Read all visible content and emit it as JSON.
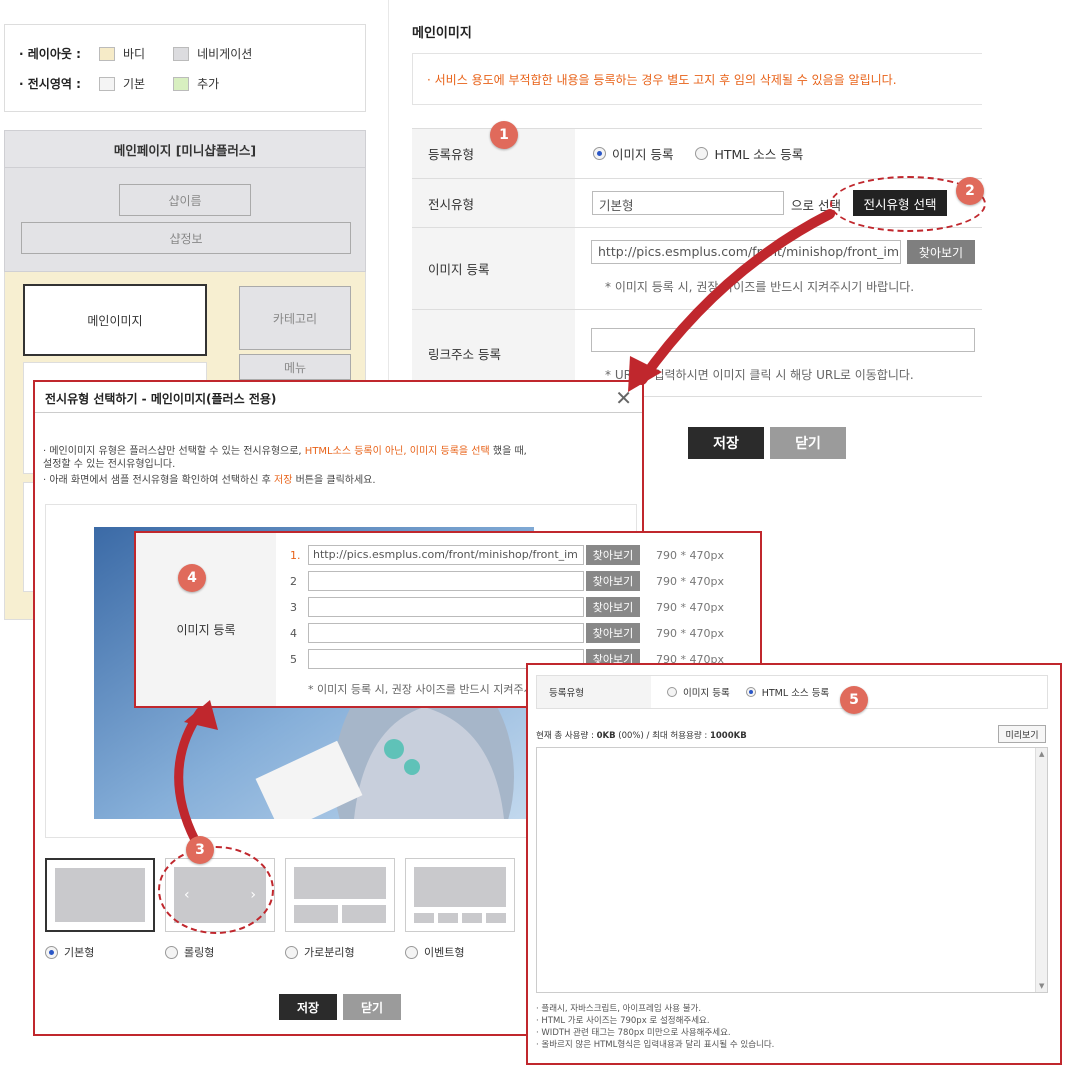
{
  "legend": {
    "layout_label": "· 레이아웃 :",
    "display_label": "· 전시영역 :",
    "items_layout": [
      {
        "label": "바디",
        "color": "#f6ebc8"
      },
      {
        "label": "네비게이션",
        "color": "#dcdcdf"
      }
    ],
    "items_display": [
      {
        "label": "기본",
        "color": "#f4f4f4"
      },
      {
        "label": "추가",
        "color": "#d8efc0"
      }
    ]
  },
  "map": {
    "title": "메인페이지 [미니샵플러스]",
    "shop_name": "샵이름",
    "shop_info": "샵정보",
    "main_image": "메인이미지",
    "category": "카테고리",
    "menu": "메뉴"
  },
  "right": {
    "section_title": "메인이미지",
    "notice": "· 서비스 용도에 부적합한 내용을 등록하는 경우 별도 고지 후 임의 삭제될 수 있음을 알립니다.",
    "reg_type_label": "등록유형",
    "reg_type_options": [
      "이미지 등록",
      "HTML 소스 등록"
    ],
    "display_type_label": "전시유형",
    "display_type_value": "기본형",
    "display_select_suffix": "으로 선택",
    "display_select_button": "전시유형 선택",
    "image_reg_label": "이미지 등록",
    "image_url": "http://pics.esmplus.com/front/minishop/front_im",
    "browse": "찾아보기",
    "image_hint": "* 이미지 등록 시, 권장 사이즈를 반드시 지켜주시기 바랍니다.",
    "link_label": "링크주소 등록",
    "link_hint": "* URL을 입력하시면 이미지 클릭 시 해당 URL로 이동합니다.",
    "save": "저장",
    "close": "닫기"
  },
  "popup": {
    "title": "전시유형 선택하기 - 메인이미지(플러스 전용)",
    "desc_line1_a": "· 메인이미지 유형은 플러스샵만 선택할 수 있는 전시유형으로, ",
    "desc_line1_b": "HTML소스 등록이 아닌, 이미지 등록을 선택",
    "desc_line1_c": " 했을 때,",
    "desc_line2": "  설정할 수 있는 전시유형입니다.",
    "desc_line3_a": "· 아래 화면에서 샘플 전시유형을 확인하여 선택하신 후 ",
    "desc_line3_b": "저장",
    "desc_line3_c": " 버튼을 클릭하세요.",
    "types": [
      "기본형",
      "롤링형",
      "가로분리형",
      "이벤트형"
    ],
    "selected_type": "기본형",
    "save": "저장",
    "close": "닫기"
  },
  "regbox": {
    "label": "이미지 등록",
    "rows": [
      {
        "num": "1.",
        "value": "http://pics.esmplus.com/front/minishop/front_im",
        "size": "790 * 470px"
      },
      {
        "num": "2",
        "value": "",
        "size": "790 * 470px"
      },
      {
        "num": "3",
        "value": "",
        "size": "790 * 470px"
      },
      {
        "num": "4",
        "value": "",
        "size": "790 * 470px"
      },
      {
        "num": "5",
        "value": "",
        "size": "790 * 470px"
      }
    ],
    "browse": "찾아보기",
    "hint": "* 이미지 등록 시, 권장 사이즈를 반드시 지켜주시"
  },
  "htmlbox": {
    "reg_type_label": "등록유형",
    "options": [
      "이미지 등록",
      "HTML 소스 등록"
    ],
    "usage_a": "현재 총 사용량 : ",
    "usage_b": "0KB",
    "usage_c": " (00%)  /  최대 허용용량 : ",
    "usage_d": "1000KB",
    "preview_button": "미리보기",
    "notes": [
      {
        "text": "· 플래시, 자바스크립트, 아이프레임 사용 불가.",
        "accent": true
      },
      {
        "text": "· HTML 가로 사이즈는 790px 로 설정해주세요.",
        "accent": false
      },
      {
        "text": "· WIDTH 관련 태그는 780px 미만으로 사용해주세요.",
        "accent": false
      },
      {
        "text": "· 올바르지 않은 HTML형식은 입력내용과 달리 표시될 수 있습니다.",
        "accent": false
      }
    ]
  },
  "badges": [
    "1",
    "2",
    "3",
    "4",
    "5"
  ],
  "colors": {
    "accent_red": "#c0272d",
    "badge": "#e06a5b",
    "notice_orange": "#e8631a",
    "dark_button": "#2b2b2b",
    "gray_button": "#9b9b9b"
  }
}
